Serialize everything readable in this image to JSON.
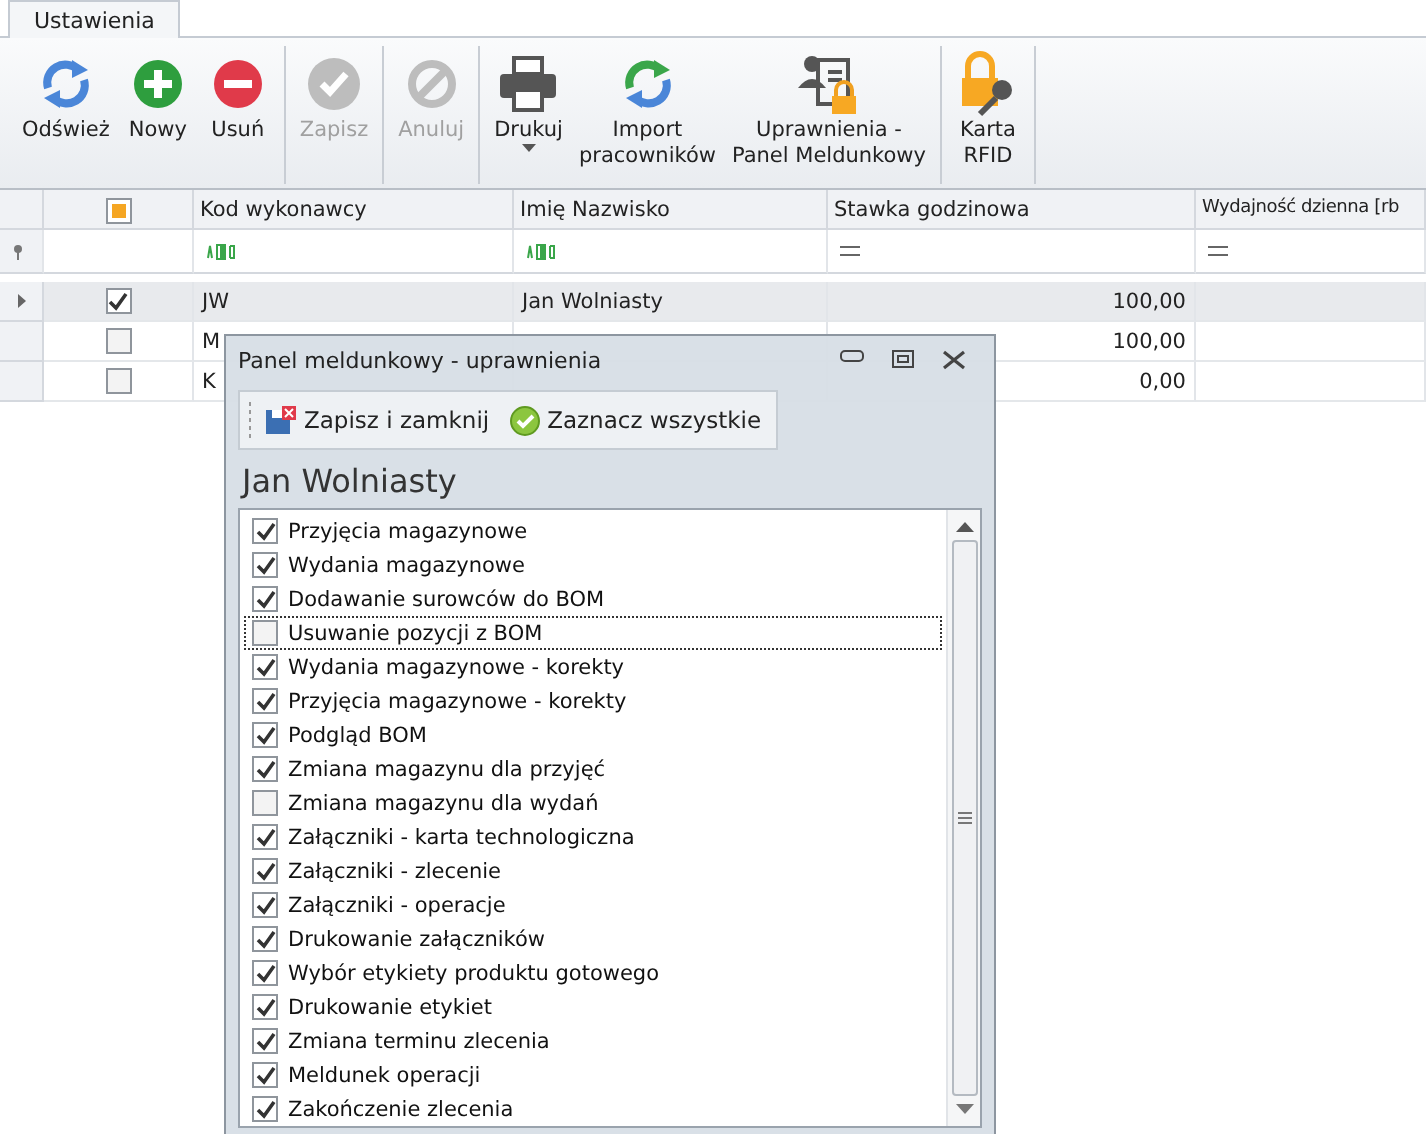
{
  "tabs": [
    {
      "label": "Ustawienia",
      "selected": true
    }
  ],
  "toolbar": {
    "groups": [
      [
        {
          "kind": "refresh",
          "lines": [
            "Odśwież"
          ],
          "disabled": false
        },
        {
          "kind": "add",
          "lines": [
            "Nowy"
          ],
          "disabled": false
        },
        {
          "kind": "remove",
          "lines": [
            "Usuń"
          ],
          "disabled": false
        }
      ],
      [
        {
          "kind": "save",
          "lines": [
            "Zapisz"
          ],
          "disabled": true
        }
      ],
      [
        {
          "kind": "cancel",
          "lines": [
            "Anuluj"
          ],
          "disabled": true
        }
      ],
      [
        {
          "kind": "print",
          "lines": [
            "Drukuj"
          ],
          "disabled": false,
          "dropdown": true
        },
        {
          "kind": "import",
          "lines": [
            "Import",
            "pracowników"
          ],
          "disabled": false
        },
        {
          "kind": "permissions",
          "lines": [
            "Uprawnienia -",
            "Panel Meldunkowy"
          ],
          "disabled": false
        }
      ],
      [
        {
          "kind": "rfid",
          "lines": [
            "Karta",
            "RFID"
          ],
          "disabled": false
        }
      ]
    ]
  },
  "grid": {
    "select_all": {
      "kind": "partial"
    },
    "columns": [
      "Kod wykonawcy",
      "Imię Nazwisko",
      "Stawka godzinowa",
      "Wydajność dzienna [rb"
    ],
    "filters": [
      {
        "kind": "text"
      },
      {
        "kind": "text"
      },
      {
        "kind": "number"
      },
      {
        "kind": "number"
      }
    ],
    "rows": [
      {
        "selected": true,
        "checked": true,
        "code": "JW",
        "name": "Jan Wolniasty",
        "rate": "100,00"
      },
      {
        "selected": false,
        "checked": false,
        "code": "M",
        "rate": "100,00"
      },
      {
        "selected": false,
        "checked": false,
        "code": "K",
        "rate": "0,00"
      }
    ]
  },
  "dialog": {
    "title": "Panel meldunkowy - uprawnienia",
    "buttons": [
      {
        "kind": "save-close",
        "label": "Zapisz i zamknij"
      },
      {
        "kind": "check-all",
        "label": "Zaznacz wszystkie"
      }
    ],
    "heading": "Jan Wolniasty",
    "permissions": [
      {
        "label": "Przyjęcia magazynowe",
        "checked": true,
        "focused": false
      },
      {
        "label": "Wydania magazynowe",
        "checked": true,
        "focused": false
      },
      {
        "label": "Dodawanie surowców do BOM",
        "checked": true,
        "focused": false
      },
      {
        "label": "Usuwanie pozycji z BOM",
        "checked": false,
        "focused": true
      },
      {
        "label": "Wydania magazynowe - korekty",
        "checked": true,
        "focused": false
      },
      {
        "label": "Przyjęcia magazynowe - korekty",
        "checked": true,
        "focused": false
      },
      {
        "label": "Podgląd BOM",
        "checked": true,
        "focused": false
      },
      {
        "label": "Zmiana magazynu dla przyjęć",
        "checked": true,
        "focused": false
      },
      {
        "label": "Zmiana magazynu dla wydań",
        "checked": false,
        "focused": false
      },
      {
        "label": "Załączniki - karta technologiczna",
        "checked": true,
        "focused": false
      },
      {
        "label": "Załączniki - zlecenie",
        "checked": true,
        "focused": false
      },
      {
        "label": "Załączniki - operacje",
        "checked": true,
        "focused": false
      },
      {
        "label": "Drukowanie załączników",
        "checked": true,
        "focused": false
      },
      {
        "label": "Wybór etykiety produktu gotowego",
        "checked": true,
        "focused": false
      },
      {
        "label": "Drukowanie etykiet",
        "checked": true,
        "focused": false
      },
      {
        "label": "Zmiana terminu zlecenia",
        "checked": true,
        "focused": false
      },
      {
        "label": "Meldunek operacji",
        "checked": true,
        "focused": false
      },
      {
        "label": "Zakończenie zlecenia",
        "checked": true,
        "focused": false
      }
    ]
  }
}
